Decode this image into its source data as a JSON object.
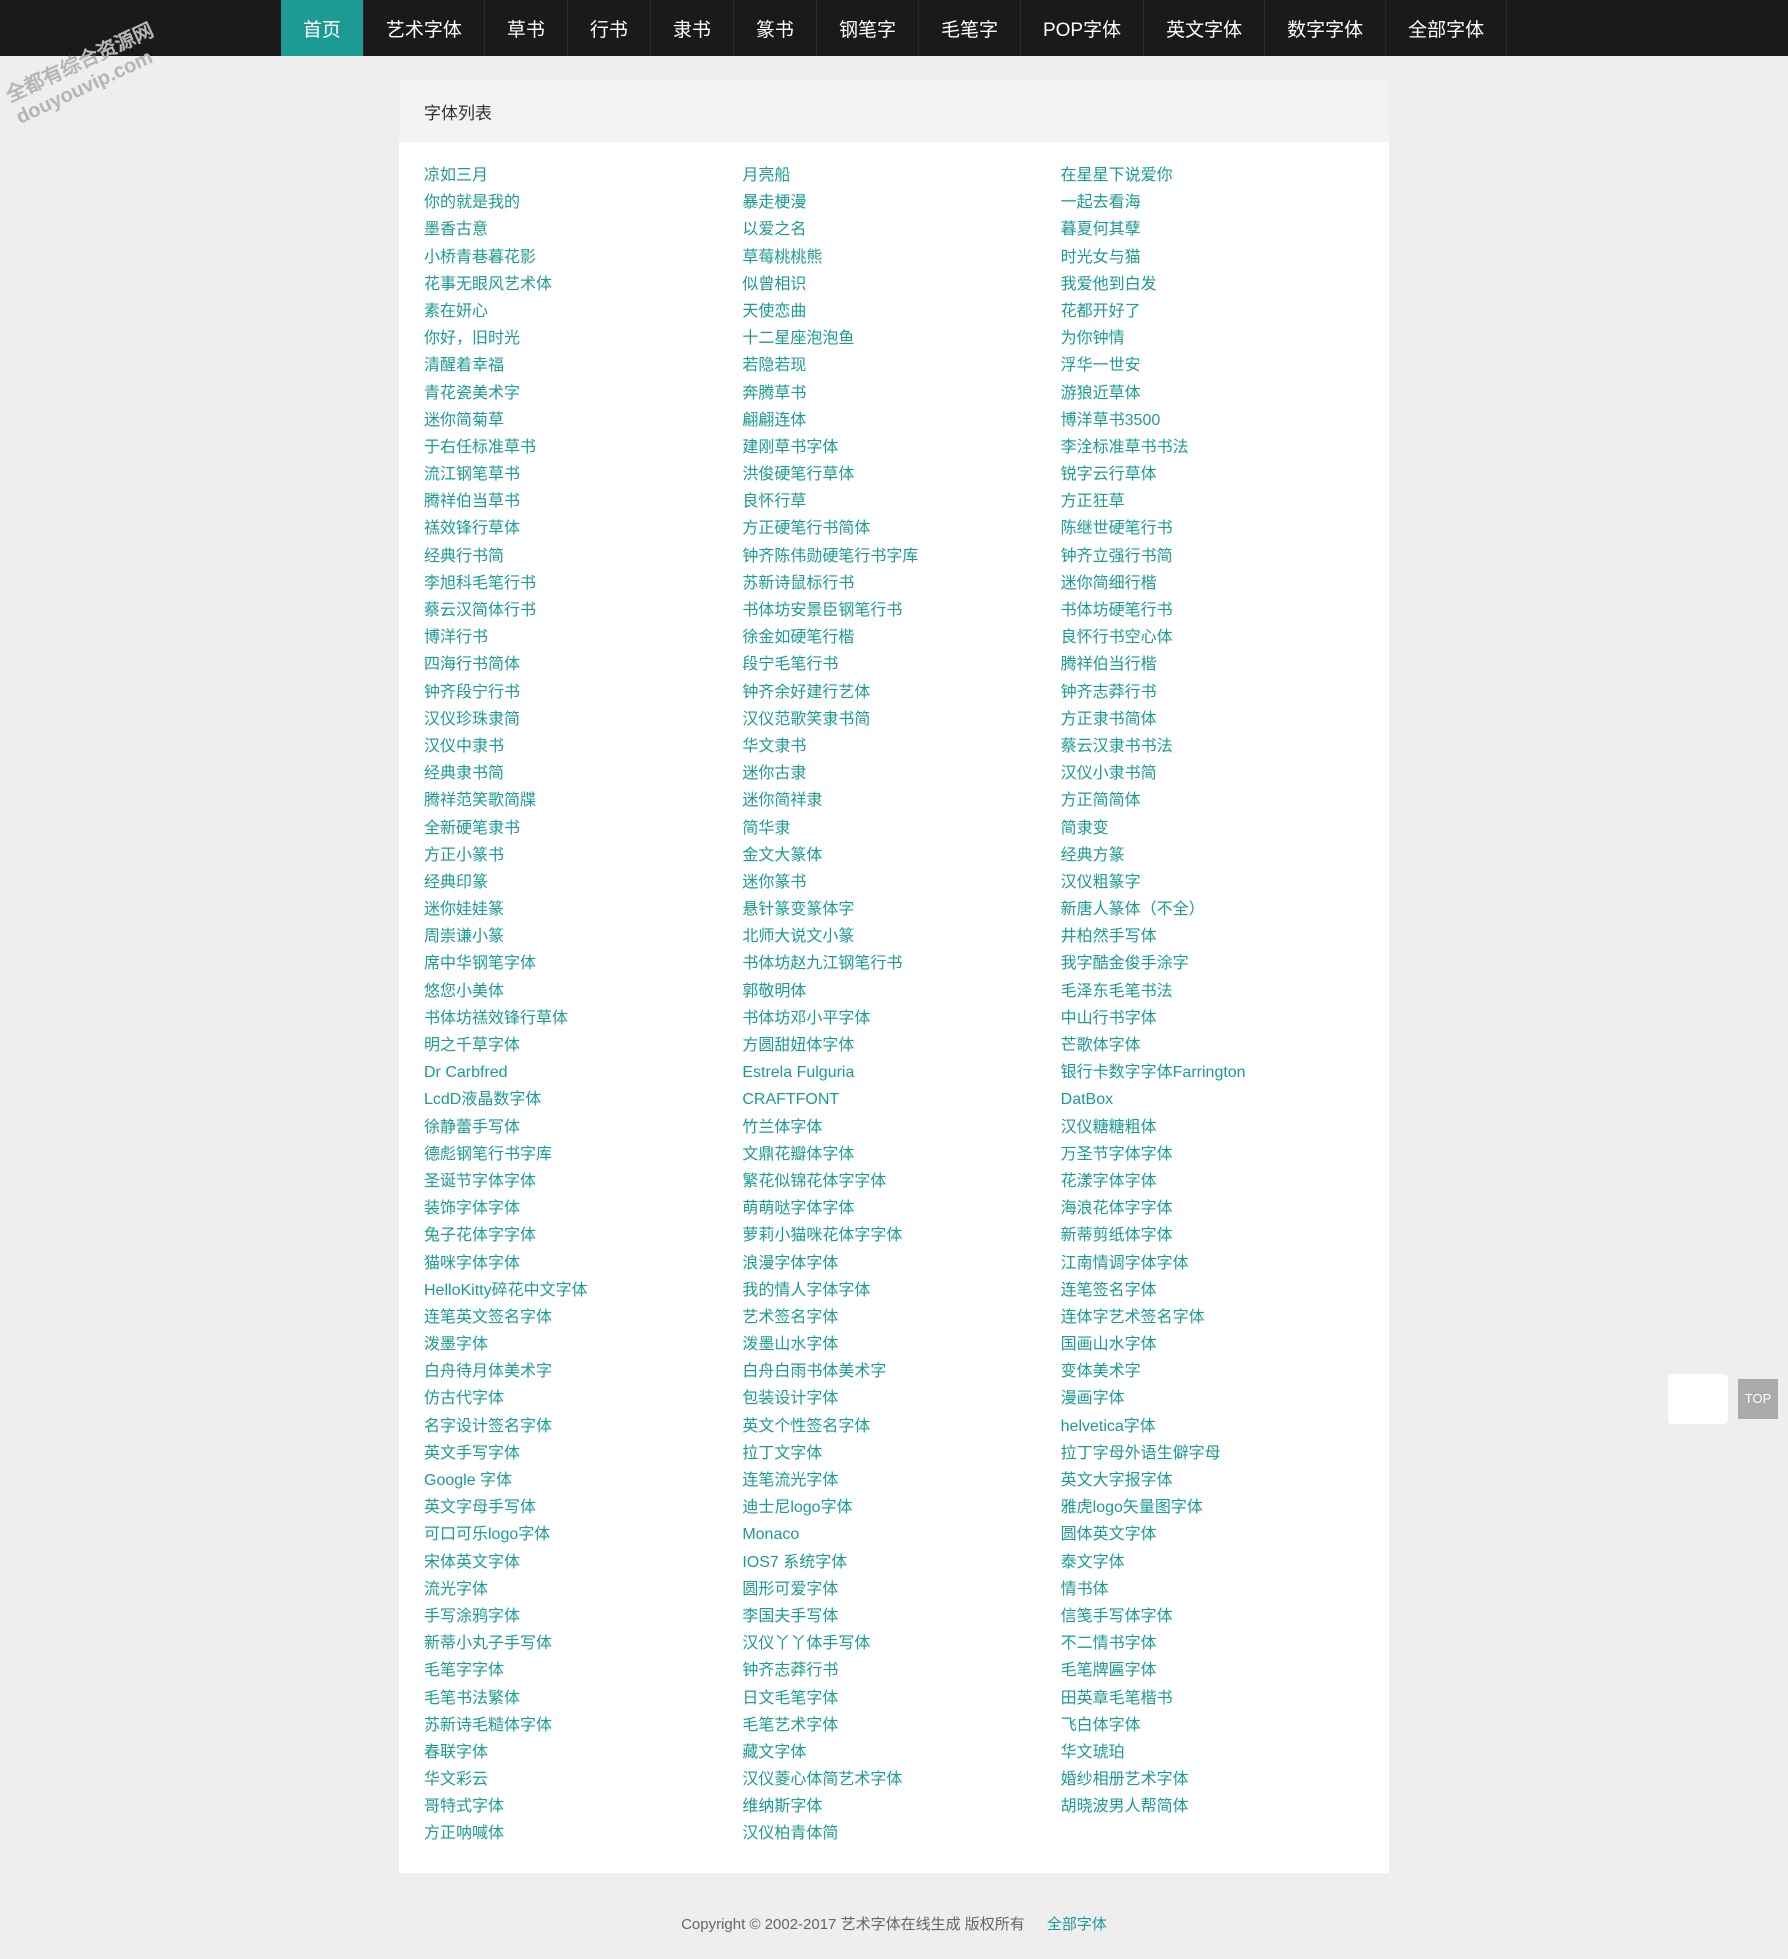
{
  "watermark": {
    "line1": "全都有综合资源网",
    "line2": "douyouvip.com"
  },
  "nav": {
    "items": [
      {
        "label": "首页",
        "active": true
      },
      {
        "label": "艺术字体",
        "active": false
      },
      {
        "label": "草书",
        "active": false
      },
      {
        "label": "行书",
        "active": false
      },
      {
        "label": "隶书",
        "active": false
      },
      {
        "label": "篆书",
        "active": false
      },
      {
        "label": "钢笔字",
        "active": false
      },
      {
        "label": "毛笔字",
        "active": false
      },
      {
        "label": "POP字体",
        "active": false
      },
      {
        "label": "英文字体",
        "active": false
      },
      {
        "label": "数字字体",
        "active": false
      },
      {
        "label": "全部字体",
        "active": false
      }
    ]
  },
  "header": {
    "title": "字体列表"
  },
  "fonts": {
    "col1": [
      "凉如三月",
      "你的就是我的",
      "墨香古意",
      "小桥青巷暮花影",
      "花事无眼风艺术体",
      "素在妍心",
      "你好，旧时光",
      "清醒着幸福",
      "青花瓷美术字",
      "迷你简菊草",
      "于右任标准草书",
      "流江钢笔草书",
      "腾祥伯当草书",
      "禚效锋行草体",
      "经典行书简",
      "李旭科毛笔行书",
      "蔡云汉简体行书",
      "博洋行书",
      "四海行书简体",
      "钟齐段宁行书",
      "汉仪珍珠隶简",
      "汉仪中隶书",
      "经典隶书简",
      "腾祥范笑歌简牒",
      "全新硬笔隶书",
      "方正小篆书",
      "经典印篆",
      "迷你娃娃篆",
      "周崇谦小篆",
      "席中华钢笔字体",
      "悠您小美体",
      "书体坊禚效锋行草体",
      "明之千草字体",
      "Dr Carbfred",
      "LcdD液晶数字体",
      "徐静蕾手写体",
      "德彪钢笔行书字库",
      "圣诞节字体字体",
      "装饰字体字体",
      "兔子花体字字体",
      "猫咪字体字体",
      "HelloKitty碎花中文字体",
      "连笔英文签名字体",
      "泼墨字体",
      "白舟待月体美术字",
      "仿古代字体",
      "名字设计签名字体",
      "英文手写字体",
      "Google 字体",
      "英文字母手写体",
      "可口可乐logo字体",
      "宋体英文字体",
      "流光字体",
      "手写涂鸦字体",
      "新蒂小丸子手写体",
      "毛笔字字体",
      "毛笔书法繁体",
      "苏新诗毛糙体字体",
      "春联字体",
      "华文彩云",
      "哥特式字体",
      "方正呐喊体"
    ],
    "col2": [
      "月亮船",
      "暴走梗漫",
      "以爱之名",
      "草莓桃桃熊",
      "似曾相识",
      "天使恋曲",
      "十二星座泡泡鱼",
      "若隐若现",
      "奔腾草书",
      "翩翩连体",
      "建刚草书字体",
      "洪俊硬笔行草体",
      "良怀行草",
      "方正硬笔行书简体",
      "钟齐陈伟勋硬笔行书字库",
      "苏新诗鼠标行书",
      "书体坊安景臣钢笔行书",
      "徐金如硬笔行楷",
      "段宁毛笔行书",
      "钟齐余好建行艺体",
      "汉仪范歌笑隶书简",
      "华文隶书",
      "迷你古隶",
      "迷你简祥隶",
      "简华隶",
      "金文大篆体",
      "迷你篆书",
      "悬针篆变篆体字",
      "北师大说文小篆",
      "书体坊赵九江钢笔行书",
      "郭敬明体",
      "书体坊邓小平字体",
      "方圆甜妞体字体",
      "Estrela Fulguria",
      "CRAFTFONT",
      "竹兰体字体",
      "文鼎花瓣体字体",
      "繁花似锦花体字字体",
      "萌萌哒字体字体",
      "萝莉小猫咪花体字字体",
      "浪漫字体字体",
      "我的情人字体字体",
      "艺术签名字体",
      "泼墨山水字体",
      "白舟白雨书体美术字",
      "包装设计字体",
      "英文个性签名字体",
      "拉丁文字体",
      "连笔流光字体",
      "迪士尼logo字体",
      "Monaco",
      "IOS7 系统字体",
      "圆形可爱字体",
      "李国夫手写体",
      "汉仪丫丫体手写体",
      "钟齐志莽行书",
      "日文毛笔字体",
      "毛笔艺术字体",
      "藏文字体",
      "汉仪菱心体简艺术字体",
      "维纳斯字体",
      "汉仪柏青体简"
    ],
    "col3": [
      "在星星下说爱你",
      "一起去看海",
      "暮夏何其孽",
      "时光女与猫",
      "我爱他到白发",
      "花都开好了",
      "为你钟情",
      "浮华一世安",
      "游狼近草体",
      "博洋草书3500",
      "李洤标准草书书法",
      "锐字云行草体",
      "方正狂草",
      "陈继世硬笔行书",
      "钟齐立强行书简",
      "迷你简细行楷",
      "书体坊硬笔行书",
      "良怀行书空心体",
      "腾祥伯当行楷",
      "钟齐志莽行书",
      "方正隶书简体",
      "蔡云汉隶书书法",
      "汉仪小隶书简",
      "方正简简体",
      "简隶变",
      "经典方篆",
      "汉仪粗篆字",
      "新唐人篆体（不全）",
      "井柏然手写体",
      "我字酷金俊手涂字",
      "毛泽东毛笔书法",
      "中山行书字体",
      "芒歌体字体",
      "银行卡数字字体Farrington",
      "DatBox",
      "汉仪糖糖粗体",
      "万圣节字体字体",
      "花漾字体字体",
      "海浪花体字字体",
      "新蒂剪纸体字体",
      "江南情调字体字体",
      "连笔签名字体",
      "连体字艺术签名字体",
      "国画山水字体",
      "变体美术字",
      "漫画字体",
      "helvetica字体",
      "拉丁字母外语生僻字母",
      "英文大字报字体",
      "雅虎logo矢量图字体",
      "圆体英文字体",
      "泰文字体",
      "情书体",
      "信笺手写体字体",
      "不二情书字体",
      "毛笔牌匾字体",
      "田英章毛笔楷书",
      "飞白体字体",
      "华文琥珀",
      "婚纱相册艺术字体",
      "胡晓波男人帮简体"
    ]
  },
  "footer": {
    "copyright": "Copyright © 2002-2017 艺术字体在线生成 版权所有",
    "link": "全部字体"
  },
  "top_button": "TOP"
}
